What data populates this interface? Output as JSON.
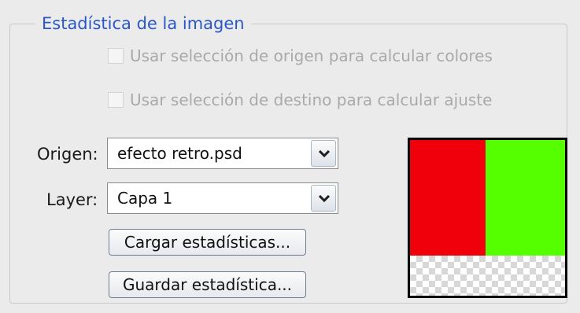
{
  "group": {
    "title": "Estadística de la imagen"
  },
  "options": {
    "use_source_selection": {
      "label": "Usar selección de origen para calcular colores",
      "checked": false,
      "enabled": false
    },
    "use_target_selection": {
      "label": "Usar selección de destino para calcular ajuste",
      "checked": false,
      "enabled": false
    }
  },
  "source": {
    "label": "Origen:",
    "value": "efecto retro.psd"
  },
  "layer": {
    "label": "Layer:",
    "value": "Capa 1"
  },
  "buttons": {
    "load": "Cargar estadísticas...",
    "save": "Guardar estadística..."
  },
  "preview": {
    "colors": {
      "left": "#ef000b",
      "right": "#55ff00",
      "transparent_pattern": "checkerboard"
    }
  }
}
